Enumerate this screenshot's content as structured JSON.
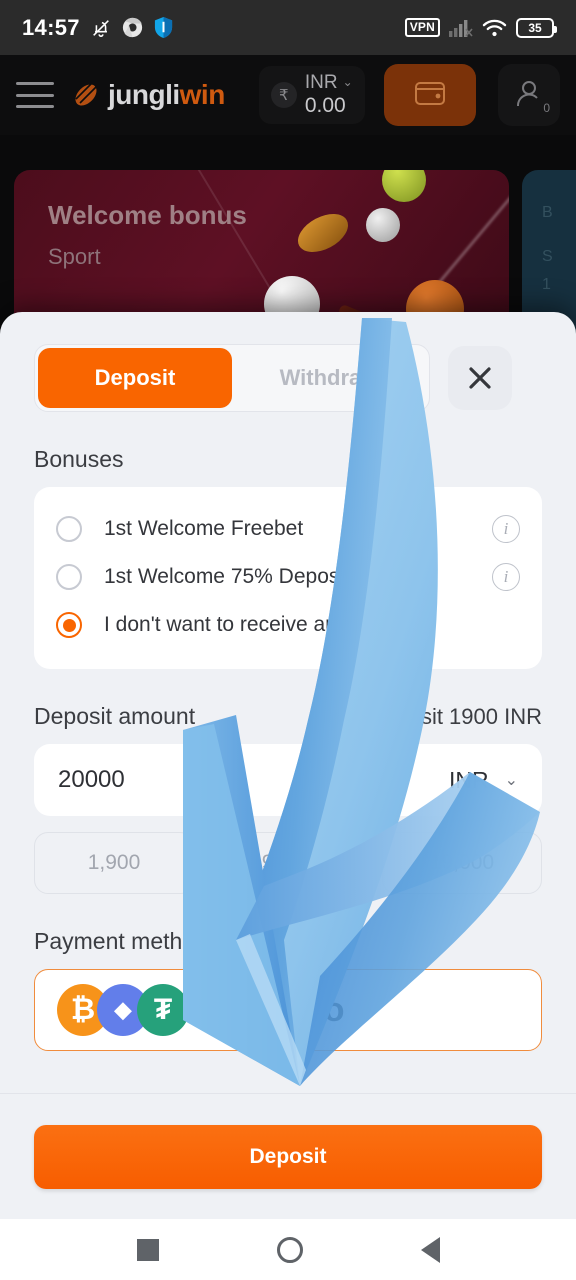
{
  "status_bar": {
    "time": "14:57",
    "icons": [
      "bell-muted-icon",
      "chrome-icon",
      "shield-icon"
    ],
    "vpn_label": "VPN",
    "battery_level": "35"
  },
  "header": {
    "menu_icon": "hamburger-menu-icon",
    "logo_first": "jungli",
    "logo_second": "win",
    "currency_symbol": "₹",
    "currency_code": "INR",
    "balance": "0.00",
    "wallet_icon": "wallet-icon",
    "profile_icon": "profile-icon",
    "profile_count": "0"
  },
  "banner": {
    "title": "Welcome bonus",
    "subtitle": "Sport"
  },
  "sheet": {
    "tabs": [
      {
        "label": "Deposit",
        "active": true
      },
      {
        "label": "Withdraw",
        "active": false
      }
    ],
    "close_label": "×",
    "bonuses": {
      "title": "Bonuses",
      "options": [
        {
          "label": "1st Welcome Freebet",
          "selected": false,
          "has_info": true
        },
        {
          "label": "1st Welcome 75% Deposit",
          "selected": false,
          "has_info": true
        },
        {
          "label": "I don't want to receive any bonus",
          "selected": true,
          "has_info": false
        }
      ]
    },
    "amount": {
      "title": "Deposit amount",
      "limit_note": "Min deposit 1900 INR",
      "value": "20000",
      "currency": "INR",
      "caret": "⌄",
      "quick_amounts": [
        "1,900",
        "9,500",
        "19,000"
      ]
    },
    "payment": {
      "title": "Payment method",
      "selected_name": "Crypto",
      "coins": [
        {
          "name": "bitcoin-icon",
          "glyph": "₿",
          "color": "#F7931A"
        },
        {
          "name": "ethereum-icon",
          "glyph": "◆",
          "color": "#627EEA"
        },
        {
          "name": "tether-icon",
          "glyph": "₮",
          "color": "#26A17B"
        }
      ]
    },
    "submit_label": "Deposit"
  },
  "overlay": {
    "annotation": "blue-down-arrow",
    "color_dark": "#4a90d9",
    "color_light": "#9ccbef"
  },
  "navbar": {
    "recents": "recents-square-icon",
    "home": "home-circle-icon",
    "back": "back-triangle-icon"
  }
}
